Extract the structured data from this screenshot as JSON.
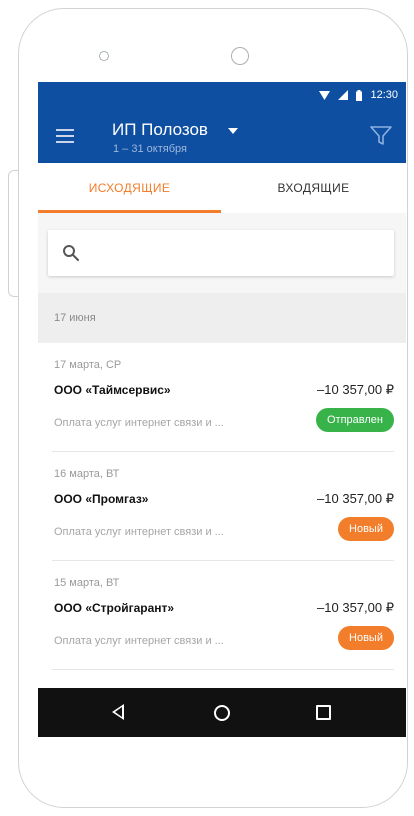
{
  "status_bar": {
    "time": "12:30"
  },
  "app_bar": {
    "title": "ИП Полозов",
    "subtitle": "1 – 31 октября"
  },
  "tabs": [
    {
      "label": "ИСХОДЯЩИЕ"
    },
    {
      "label": "ВХОДЯЩИЕ"
    }
  ],
  "search": {
    "placeholder": ""
  },
  "date_header": "17 июня",
  "items": [
    {
      "date": "17 марта, СР",
      "company": "ООО «Таймсервис»",
      "amount": "–10 357,00 ₽",
      "description": "Оплата услуг интернет связи и ...",
      "status": "Отправлен"
    },
    {
      "date": "16 марта, ВТ",
      "company": "ООО «Промгаз»",
      "amount": "–10 357,00 ₽",
      "description": "Оплата услуг интернет связи и ...",
      "status": "Новый"
    },
    {
      "date": "15 марта, ВТ",
      "company": "ООО «Стройгарант»",
      "amount": "–10 357,00 ₽",
      "description": "Оплата услуг интернет связи и ...",
      "status": "Новый"
    }
  ],
  "colors": {
    "primary": "#0e4fa1",
    "accent": "#f27d2a",
    "status_sent": "#37b34a",
    "status_new": "#f27d2a"
  }
}
